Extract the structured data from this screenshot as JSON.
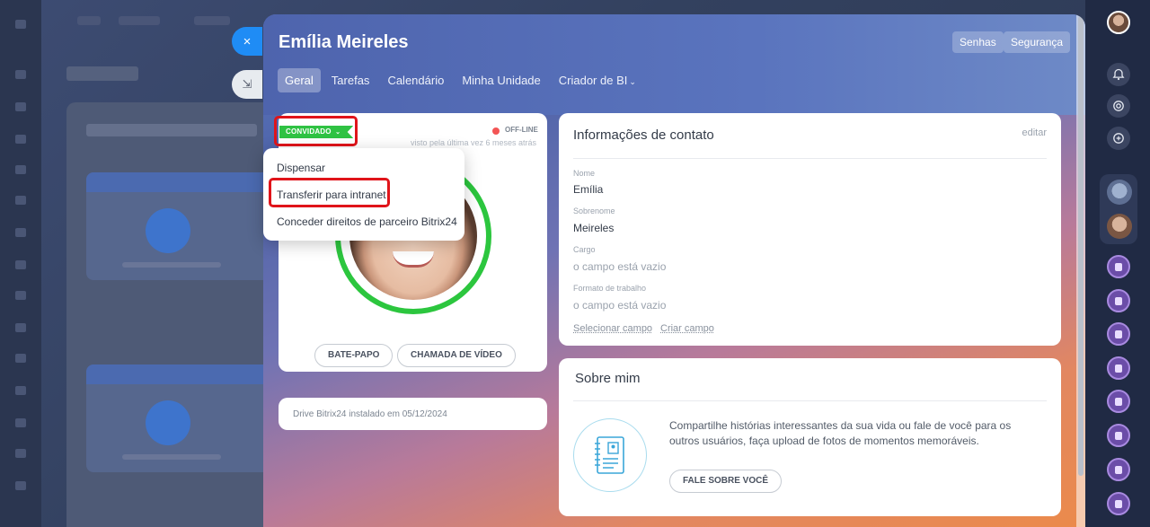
{
  "profile": {
    "name": "Emília Meireles",
    "header_buttons": [
      "Senhas",
      "Segurança"
    ],
    "tabs": [
      {
        "label": "Geral",
        "active": true
      },
      {
        "label": "Tarefas"
      },
      {
        "label": "Calendário"
      },
      {
        "label": "Minha Unidade"
      },
      {
        "label": "Criador de BI",
        "dropdown": true
      }
    ],
    "status_badge": "CONVIDADO",
    "status": "OFF-LINE",
    "last_seen": "visto pela última vez 6 meses atrás",
    "actions": [
      "BATE-PAPO",
      "CHAMADA DE VÍDEO"
    ],
    "drive_info": "Drive Bitrix24 instalado em 05/12/2024"
  },
  "dropdown_menu": {
    "items": [
      "Dispensar",
      "Transferir para intranet",
      "Conceder direitos de parceiro Bitrix24"
    ],
    "highlighted_index": 1
  },
  "contact": {
    "title": "Informações de contato",
    "edit": "editar",
    "fields": [
      {
        "label": "Nome",
        "value": "Emília"
      },
      {
        "label": "Sobrenome",
        "value": "Meireles"
      },
      {
        "label": "Cargo",
        "value": "o campo está vazio"
      },
      {
        "label": "Formato de trabalho",
        "value": "o campo está vazio"
      }
    ],
    "links": [
      "Selecionar campo",
      "Criar campo"
    ]
  },
  "about": {
    "title": "Sobre mim",
    "text": "Compartilhe histórias interessantes da sua vida ou fale de você para os outros usuários, faça upload de fotos de momentos memoráveis.",
    "button": "FALE SOBRE VOCÊ"
  },
  "icons": {
    "close": "×",
    "collapse": "⇲",
    "chevron": "⌄",
    "bell": "🔔",
    "copilot": "◎",
    "chat": "💬"
  },
  "colors": {
    "accent_green": "#2fc243",
    "highlight_red": "#e0141a",
    "close_blue": "#1f8cf5",
    "offline_dot": "#f35555"
  }
}
